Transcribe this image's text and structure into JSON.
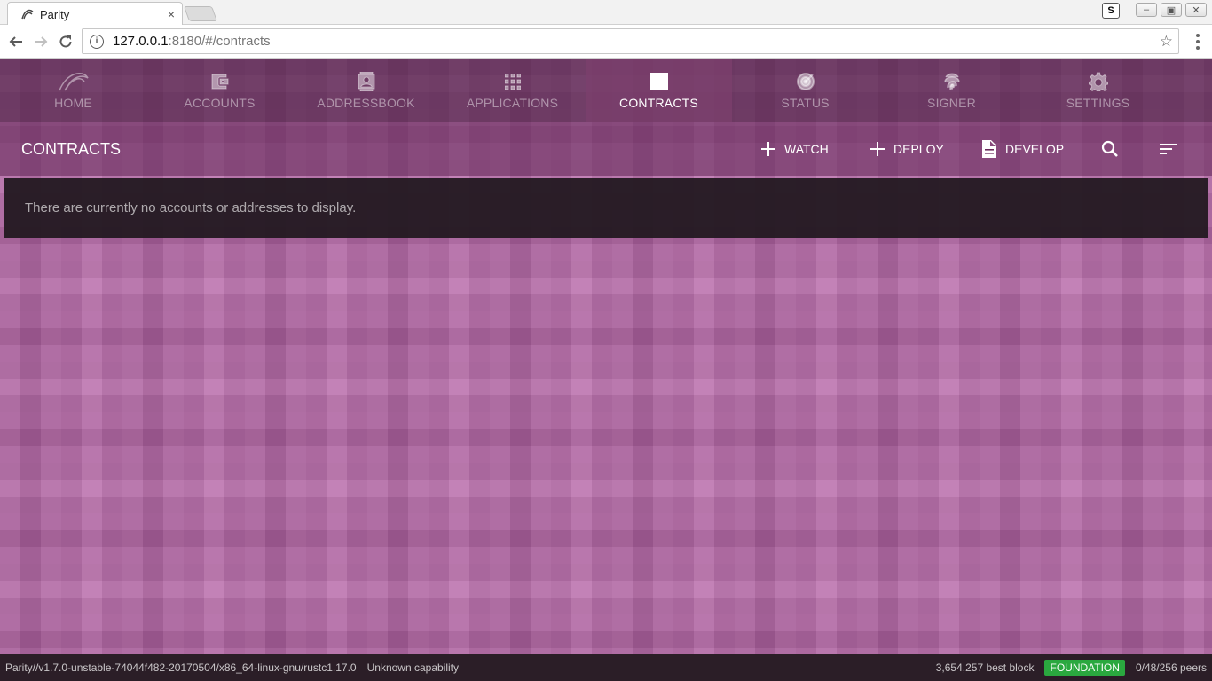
{
  "browser": {
    "tab_title": "Parity",
    "tab_close": "×",
    "url_host": "127.0.0.1",
    "url_rest": ":8180/#/contracts",
    "ext_label": "S"
  },
  "nav": {
    "items": [
      {
        "label": "HOME",
        "icon": "parity-logo-icon"
      },
      {
        "label": "ACCOUNTS",
        "icon": "wallet-icon"
      },
      {
        "label": "ADDRESSBOOK",
        "icon": "contact-card-icon"
      },
      {
        "label": "APPLICATIONS",
        "icon": "apps-grid-icon"
      },
      {
        "label": "CONTRACTS",
        "icon": "table-grid-icon",
        "active": true
      },
      {
        "label": "STATUS",
        "icon": "radar-icon"
      },
      {
        "label": "SIGNER",
        "icon": "fingerprint-icon"
      },
      {
        "label": "SETTINGS",
        "icon": "gear-icon"
      }
    ]
  },
  "actionbar": {
    "title": "CONTRACTS",
    "watch": "WATCH",
    "deploy": "DEPLOY",
    "develop": "DEVELOP"
  },
  "main": {
    "empty_message": "There are currently no accounts or addresses to display."
  },
  "status": {
    "version": "Parity//v1.7.0-unstable-74044f482-20170504/x86_64-linux-gnu/rustc1.17.0",
    "capability": "Unknown capability",
    "best_block": "3,654,257 best block",
    "chain": "FOUNDATION",
    "peers": "0/48/256 peers"
  },
  "colors": {
    "background": "#b565a6",
    "status_badge": "#2aa83f"
  }
}
